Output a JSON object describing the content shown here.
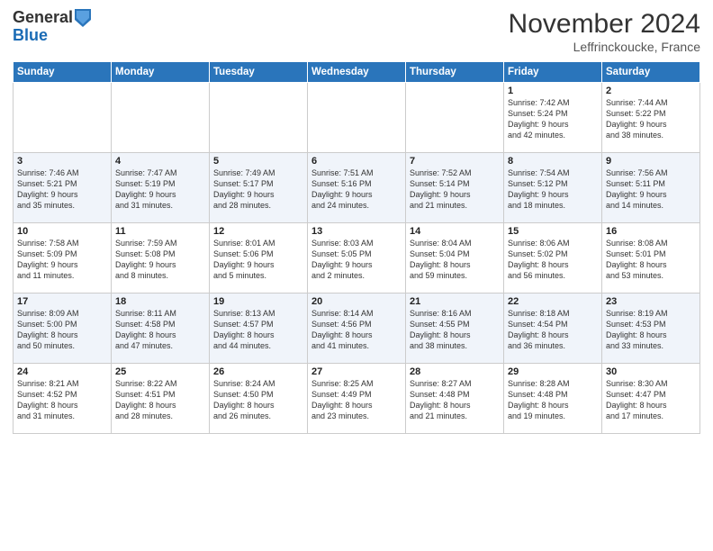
{
  "logo": {
    "general": "General",
    "blue": "Blue"
  },
  "title": "November 2024",
  "location": "Leffrinckoucke, France",
  "headers": [
    "Sunday",
    "Monday",
    "Tuesday",
    "Wednesday",
    "Thursday",
    "Friday",
    "Saturday"
  ],
  "weeks": [
    [
      {
        "day": "",
        "info": ""
      },
      {
        "day": "",
        "info": ""
      },
      {
        "day": "",
        "info": ""
      },
      {
        "day": "",
        "info": ""
      },
      {
        "day": "",
        "info": ""
      },
      {
        "day": "1",
        "info": "Sunrise: 7:42 AM\nSunset: 5:24 PM\nDaylight: 9 hours\nand 42 minutes."
      },
      {
        "day": "2",
        "info": "Sunrise: 7:44 AM\nSunset: 5:22 PM\nDaylight: 9 hours\nand 38 minutes."
      }
    ],
    [
      {
        "day": "3",
        "info": "Sunrise: 7:46 AM\nSunset: 5:21 PM\nDaylight: 9 hours\nand 35 minutes."
      },
      {
        "day": "4",
        "info": "Sunrise: 7:47 AM\nSunset: 5:19 PM\nDaylight: 9 hours\nand 31 minutes."
      },
      {
        "day": "5",
        "info": "Sunrise: 7:49 AM\nSunset: 5:17 PM\nDaylight: 9 hours\nand 28 minutes."
      },
      {
        "day": "6",
        "info": "Sunrise: 7:51 AM\nSunset: 5:16 PM\nDaylight: 9 hours\nand 24 minutes."
      },
      {
        "day": "7",
        "info": "Sunrise: 7:52 AM\nSunset: 5:14 PM\nDaylight: 9 hours\nand 21 minutes."
      },
      {
        "day": "8",
        "info": "Sunrise: 7:54 AM\nSunset: 5:12 PM\nDaylight: 9 hours\nand 18 minutes."
      },
      {
        "day": "9",
        "info": "Sunrise: 7:56 AM\nSunset: 5:11 PM\nDaylight: 9 hours\nand 14 minutes."
      }
    ],
    [
      {
        "day": "10",
        "info": "Sunrise: 7:58 AM\nSunset: 5:09 PM\nDaylight: 9 hours\nand 11 minutes."
      },
      {
        "day": "11",
        "info": "Sunrise: 7:59 AM\nSunset: 5:08 PM\nDaylight: 9 hours\nand 8 minutes."
      },
      {
        "day": "12",
        "info": "Sunrise: 8:01 AM\nSunset: 5:06 PM\nDaylight: 9 hours\nand 5 minutes."
      },
      {
        "day": "13",
        "info": "Sunrise: 8:03 AM\nSunset: 5:05 PM\nDaylight: 9 hours\nand 2 minutes."
      },
      {
        "day": "14",
        "info": "Sunrise: 8:04 AM\nSunset: 5:04 PM\nDaylight: 8 hours\nand 59 minutes."
      },
      {
        "day": "15",
        "info": "Sunrise: 8:06 AM\nSunset: 5:02 PM\nDaylight: 8 hours\nand 56 minutes."
      },
      {
        "day": "16",
        "info": "Sunrise: 8:08 AM\nSunset: 5:01 PM\nDaylight: 8 hours\nand 53 minutes."
      }
    ],
    [
      {
        "day": "17",
        "info": "Sunrise: 8:09 AM\nSunset: 5:00 PM\nDaylight: 8 hours\nand 50 minutes."
      },
      {
        "day": "18",
        "info": "Sunrise: 8:11 AM\nSunset: 4:58 PM\nDaylight: 8 hours\nand 47 minutes."
      },
      {
        "day": "19",
        "info": "Sunrise: 8:13 AM\nSunset: 4:57 PM\nDaylight: 8 hours\nand 44 minutes."
      },
      {
        "day": "20",
        "info": "Sunrise: 8:14 AM\nSunset: 4:56 PM\nDaylight: 8 hours\nand 41 minutes."
      },
      {
        "day": "21",
        "info": "Sunrise: 8:16 AM\nSunset: 4:55 PM\nDaylight: 8 hours\nand 38 minutes."
      },
      {
        "day": "22",
        "info": "Sunrise: 8:18 AM\nSunset: 4:54 PM\nDaylight: 8 hours\nand 36 minutes."
      },
      {
        "day": "23",
        "info": "Sunrise: 8:19 AM\nSunset: 4:53 PM\nDaylight: 8 hours\nand 33 minutes."
      }
    ],
    [
      {
        "day": "24",
        "info": "Sunrise: 8:21 AM\nSunset: 4:52 PM\nDaylight: 8 hours\nand 31 minutes."
      },
      {
        "day": "25",
        "info": "Sunrise: 8:22 AM\nSunset: 4:51 PM\nDaylight: 8 hours\nand 28 minutes."
      },
      {
        "day": "26",
        "info": "Sunrise: 8:24 AM\nSunset: 4:50 PM\nDaylight: 8 hours\nand 26 minutes."
      },
      {
        "day": "27",
        "info": "Sunrise: 8:25 AM\nSunset: 4:49 PM\nDaylight: 8 hours\nand 23 minutes."
      },
      {
        "day": "28",
        "info": "Sunrise: 8:27 AM\nSunset: 4:48 PM\nDaylight: 8 hours\nand 21 minutes."
      },
      {
        "day": "29",
        "info": "Sunrise: 8:28 AM\nSunset: 4:48 PM\nDaylight: 8 hours\nand 19 minutes."
      },
      {
        "day": "30",
        "info": "Sunrise: 8:30 AM\nSunset: 4:47 PM\nDaylight: 8 hours\nand 17 minutes."
      }
    ]
  ]
}
